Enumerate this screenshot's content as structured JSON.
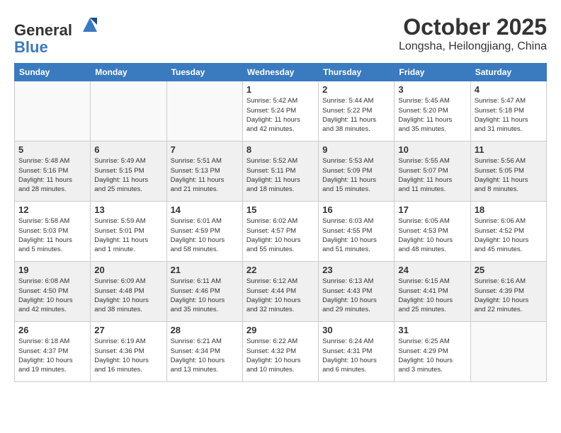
{
  "header": {
    "logo_general": "General",
    "logo_blue": "Blue",
    "month": "October 2025",
    "location": "Longsha, Heilongjiang, China"
  },
  "days_of_week": [
    "Sunday",
    "Monday",
    "Tuesday",
    "Wednesday",
    "Thursday",
    "Friday",
    "Saturday"
  ],
  "weeks": [
    [
      {
        "day": "",
        "info": ""
      },
      {
        "day": "",
        "info": ""
      },
      {
        "day": "",
        "info": ""
      },
      {
        "day": "1",
        "info": "Sunrise: 5:42 AM\nSunset: 5:24 PM\nDaylight: 11 hours\nand 42 minutes."
      },
      {
        "day": "2",
        "info": "Sunrise: 5:44 AM\nSunset: 5:22 PM\nDaylight: 11 hours\nand 38 minutes."
      },
      {
        "day": "3",
        "info": "Sunrise: 5:45 AM\nSunset: 5:20 PM\nDaylight: 11 hours\nand 35 minutes."
      },
      {
        "day": "4",
        "info": "Sunrise: 5:47 AM\nSunset: 5:18 PM\nDaylight: 11 hours\nand 31 minutes."
      }
    ],
    [
      {
        "day": "5",
        "info": "Sunrise: 5:48 AM\nSunset: 5:16 PM\nDaylight: 11 hours\nand 28 minutes."
      },
      {
        "day": "6",
        "info": "Sunrise: 5:49 AM\nSunset: 5:15 PM\nDaylight: 11 hours\nand 25 minutes."
      },
      {
        "day": "7",
        "info": "Sunrise: 5:51 AM\nSunset: 5:13 PM\nDaylight: 11 hours\nand 21 minutes."
      },
      {
        "day": "8",
        "info": "Sunrise: 5:52 AM\nSunset: 5:11 PM\nDaylight: 11 hours\nand 18 minutes."
      },
      {
        "day": "9",
        "info": "Sunrise: 5:53 AM\nSunset: 5:09 PM\nDaylight: 11 hours\nand 15 minutes."
      },
      {
        "day": "10",
        "info": "Sunrise: 5:55 AM\nSunset: 5:07 PM\nDaylight: 11 hours\nand 11 minutes."
      },
      {
        "day": "11",
        "info": "Sunrise: 5:56 AM\nSunset: 5:05 PM\nDaylight: 11 hours\nand 8 minutes."
      }
    ],
    [
      {
        "day": "12",
        "info": "Sunrise: 5:58 AM\nSunset: 5:03 PM\nDaylight: 11 hours\nand 5 minutes."
      },
      {
        "day": "13",
        "info": "Sunrise: 5:59 AM\nSunset: 5:01 PM\nDaylight: 11 hours\nand 1 minute."
      },
      {
        "day": "14",
        "info": "Sunrise: 6:01 AM\nSunset: 4:59 PM\nDaylight: 10 hours\nand 58 minutes."
      },
      {
        "day": "15",
        "info": "Sunrise: 6:02 AM\nSunset: 4:57 PM\nDaylight: 10 hours\nand 55 minutes."
      },
      {
        "day": "16",
        "info": "Sunrise: 6:03 AM\nSunset: 4:55 PM\nDaylight: 10 hours\nand 51 minutes."
      },
      {
        "day": "17",
        "info": "Sunrise: 6:05 AM\nSunset: 4:53 PM\nDaylight: 10 hours\nand 48 minutes."
      },
      {
        "day": "18",
        "info": "Sunrise: 6:06 AM\nSunset: 4:52 PM\nDaylight: 10 hours\nand 45 minutes."
      }
    ],
    [
      {
        "day": "19",
        "info": "Sunrise: 6:08 AM\nSunset: 4:50 PM\nDaylight: 10 hours\nand 42 minutes."
      },
      {
        "day": "20",
        "info": "Sunrise: 6:09 AM\nSunset: 4:48 PM\nDaylight: 10 hours\nand 38 minutes."
      },
      {
        "day": "21",
        "info": "Sunrise: 6:11 AM\nSunset: 4:46 PM\nDaylight: 10 hours\nand 35 minutes."
      },
      {
        "day": "22",
        "info": "Sunrise: 6:12 AM\nSunset: 4:44 PM\nDaylight: 10 hours\nand 32 minutes."
      },
      {
        "day": "23",
        "info": "Sunrise: 6:13 AM\nSunset: 4:43 PM\nDaylight: 10 hours\nand 29 minutes."
      },
      {
        "day": "24",
        "info": "Sunrise: 6:15 AM\nSunset: 4:41 PM\nDaylight: 10 hours\nand 25 minutes."
      },
      {
        "day": "25",
        "info": "Sunrise: 6:16 AM\nSunset: 4:39 PM\nDaylight: 10 hours\nand 22 minutes."
      }
    ],
    [
      {
        "day": "26",
        "info": "Sunrise: 6:18 AM\nSunset: 4:37 PM\nDaylight: 10 hours\nand 19 minutes."
      },
      {
        "day": "27",
        "info": "Sunrise: 6:19 AM\nSunset: 4:36 PM\nDaylight: 10 hours\nand 16 minutes."
      },
      {
        "day": "28",
        "info": "Sunrise: 6:21 AM\nSunset: 4:34 PM\nDaylight: 10 hours\nand 13 minutes."
      },
      {
        "day": "29",
        "info": "Sunrise: 6:22 AM\nSunset: 4:32 PM\nDaylight: 10 hours\nand 10 minutes."
      },
      {
        "day": "30",
        "info": "Sunrise: 6:24 AM\nSunset: 4:31 PM\nDaylight: 10 hours\nand 6 minutes."
      },
      {
        "day": "31",
        "info": "Sunrise: 6:25 AM\nSunset: 4:29 PM\nDaylight: 10 hours\nand 3 minutes."
      },
      {
        "day": "",
        "info": ""
      }
    ]
  ]
}
